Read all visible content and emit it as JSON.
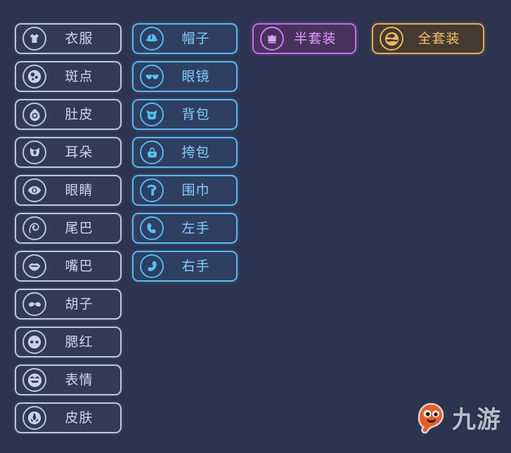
{
  "background_color": "#2d3450",
  "columns": {
    "body": {
      "name": "body-parts-column",
      "theme_color": "#b9c6e2",
      "items": [
        {
          "label": "衣服",
          "icon": "shirt-icon"
        },
        {
          "label": "斑点",
          "icon": "spots-icon"
        },
        {
          "label": "肚皮",
          "icon": "belly-icon"
        },
        {
          "label": "耳朵",
          "icon": "ears-icon"
        },
        {
          "label": "眼睛",
          "icon": "eye-icon"
        },
        {
          "label": "尾巴",
          "icon": "tail-icon"
        },
        {
          "label": "嘴巴",
          "icon": "mouth-icon"
        },
        {
          "label": "胡子",
          "icon": "mustache-icon"
        },
        {
          "label": "腮红",
          "icon": "blush-icon"
        },
        {
          "label": "表情",
          "icon": "expression-icon"
        },
        {
          "label": "皮肤",
          "icon": "skin-icon"
        }
      ]
    },
    "accessories": {
      "name": "accessories-column",
      "theme_color": "#56b9f0",
      "items": [
        {
          "label": "帽子",
          "icon": "hat-icon"
        },
        {
          "label": "眼镜",
          "icon": "glasses-icon"
        },
        {
          "label": "背包",
          "icon": "backpack-icon"
        },
        {
          "label": "挎包",
          "icon": "shoulder-bag-icon"
        },
        {
          "label": "围巾",
          "icon": "scarf-icon"
        },
        {
          "label": "左手",
          "icon": "left-hand-icon"
        },
        {
          "label": "右手",
          "icon": "right-hand-icon"
        }
      ]
    },
    "suits": {
      "name": "suits-row",
      "items": [
        {
          "label": "半套装",
          "icon": "half-suit-icon",
          "theme_color": "#c768f0"
        },
        {
          "label": "全套装",
          "icon": "full-suit-icon",
          "theme_color": "#e6ab57"
        }
      ]
    }
  },
  "watermark": {
    "text": "九游",
    "icon": "jiuyou-mascot-icon",
    "mascot_color": "#f4581c"
  }
}
